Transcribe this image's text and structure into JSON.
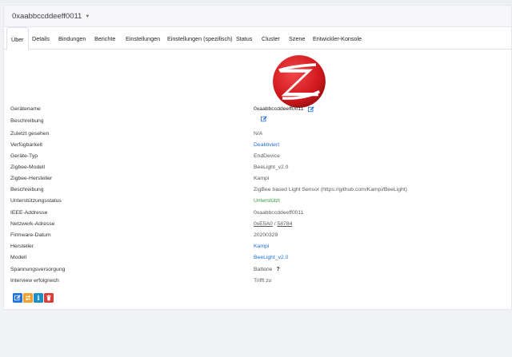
{
  "device": {
    "name": "0xaabbccddeeff0011"
  },
  "tabs": [
    {
      "label": "Über",
      "active": true
    },
    {
      "label": "Details"
    },
    {
      "label": "Bindungen"
    },
    {
      "label": "Berichte"
    },
    {
      "label": "Einstellungen"
    },
    {
      "label": "Einstellungen (spezifisch)"
    },
    {
      "label": "Status"
    },
    {
      "label": "Cluster"
    },
    {
      "label": "Szene"
    },
    {
      "label": "Entwickler-Konsole"
    }
  ],
  "details": [
    {
      "label": "Gerätename",
      "value": "0xaabbccddeeff0011"
    },
    {
      "label": "Beschreibung",
      "value": ""
    },
    {
      "label": "Zuletzt gesehen",
      "value": "N/A"
    },
    {
      "label": "Verfügbarkeit",
      "value": "Deaktiviert"
    },
    {
      "label": "Geräte-Typ",
      "value": "EndDevice"
    },
    {
      "label": "Zigbee-Modell",
      "value": "BeeLight_v2.0"
    },
    {
      "label": "Zigbee-Hersteller",
      "value": "Kampi"
    },
    {
      "label": "Beschreibung",
      "value": "ZigBee based Light Sensor (https://github.com/Kampi/BeeLight)"
    },
    {
      "label": "Unterstützungsstatus",
      "value": "Unterstützt"
    },
    {
      "label": "IEEE-Addresse",
      "value": "0xaabbccddeeff0011"
    },
    {
      "label": "Netzwerk-Adresse",
      "value": "0xE5A0",
      "value2": "58784",
      "separator": " / "
    },
    {
      "label": "Firmware-Datum",
      "value": "20200329"
    },
    {
      "label": "Hersteller",
      "value": "Kampi"
    },
    {
      "label": "Modell",
      "value": "BeeLight_v2.0"
    },
    {
      "label": "Spannungsversorgung",
      "value": "Batterie",
      "extra": "?"
    },
    {
      "label": "Interview erfolgreich",
      "value": "Trifft zu"
    }
  ],
  "colors": {
    "link": "#1f6fd6",
    "success": "#2e9e3e",
    "primary_button": "#1f72e0",
    "warning_button": "#f0a02c",
    "info_button": "#1b8ec3",
    "danger_button": "#dc3b39",
    "logo_red": "#d0181c"
  },
  "icons": {
    "logo": "zigbee-logo",
    "rename": "edit-icon",
    "description": "edit-icon",
    "actions": [
      "edit-icon",
      "swap-icon",
      "info-icon",
      "trash-icon"
    ]
  }
}
